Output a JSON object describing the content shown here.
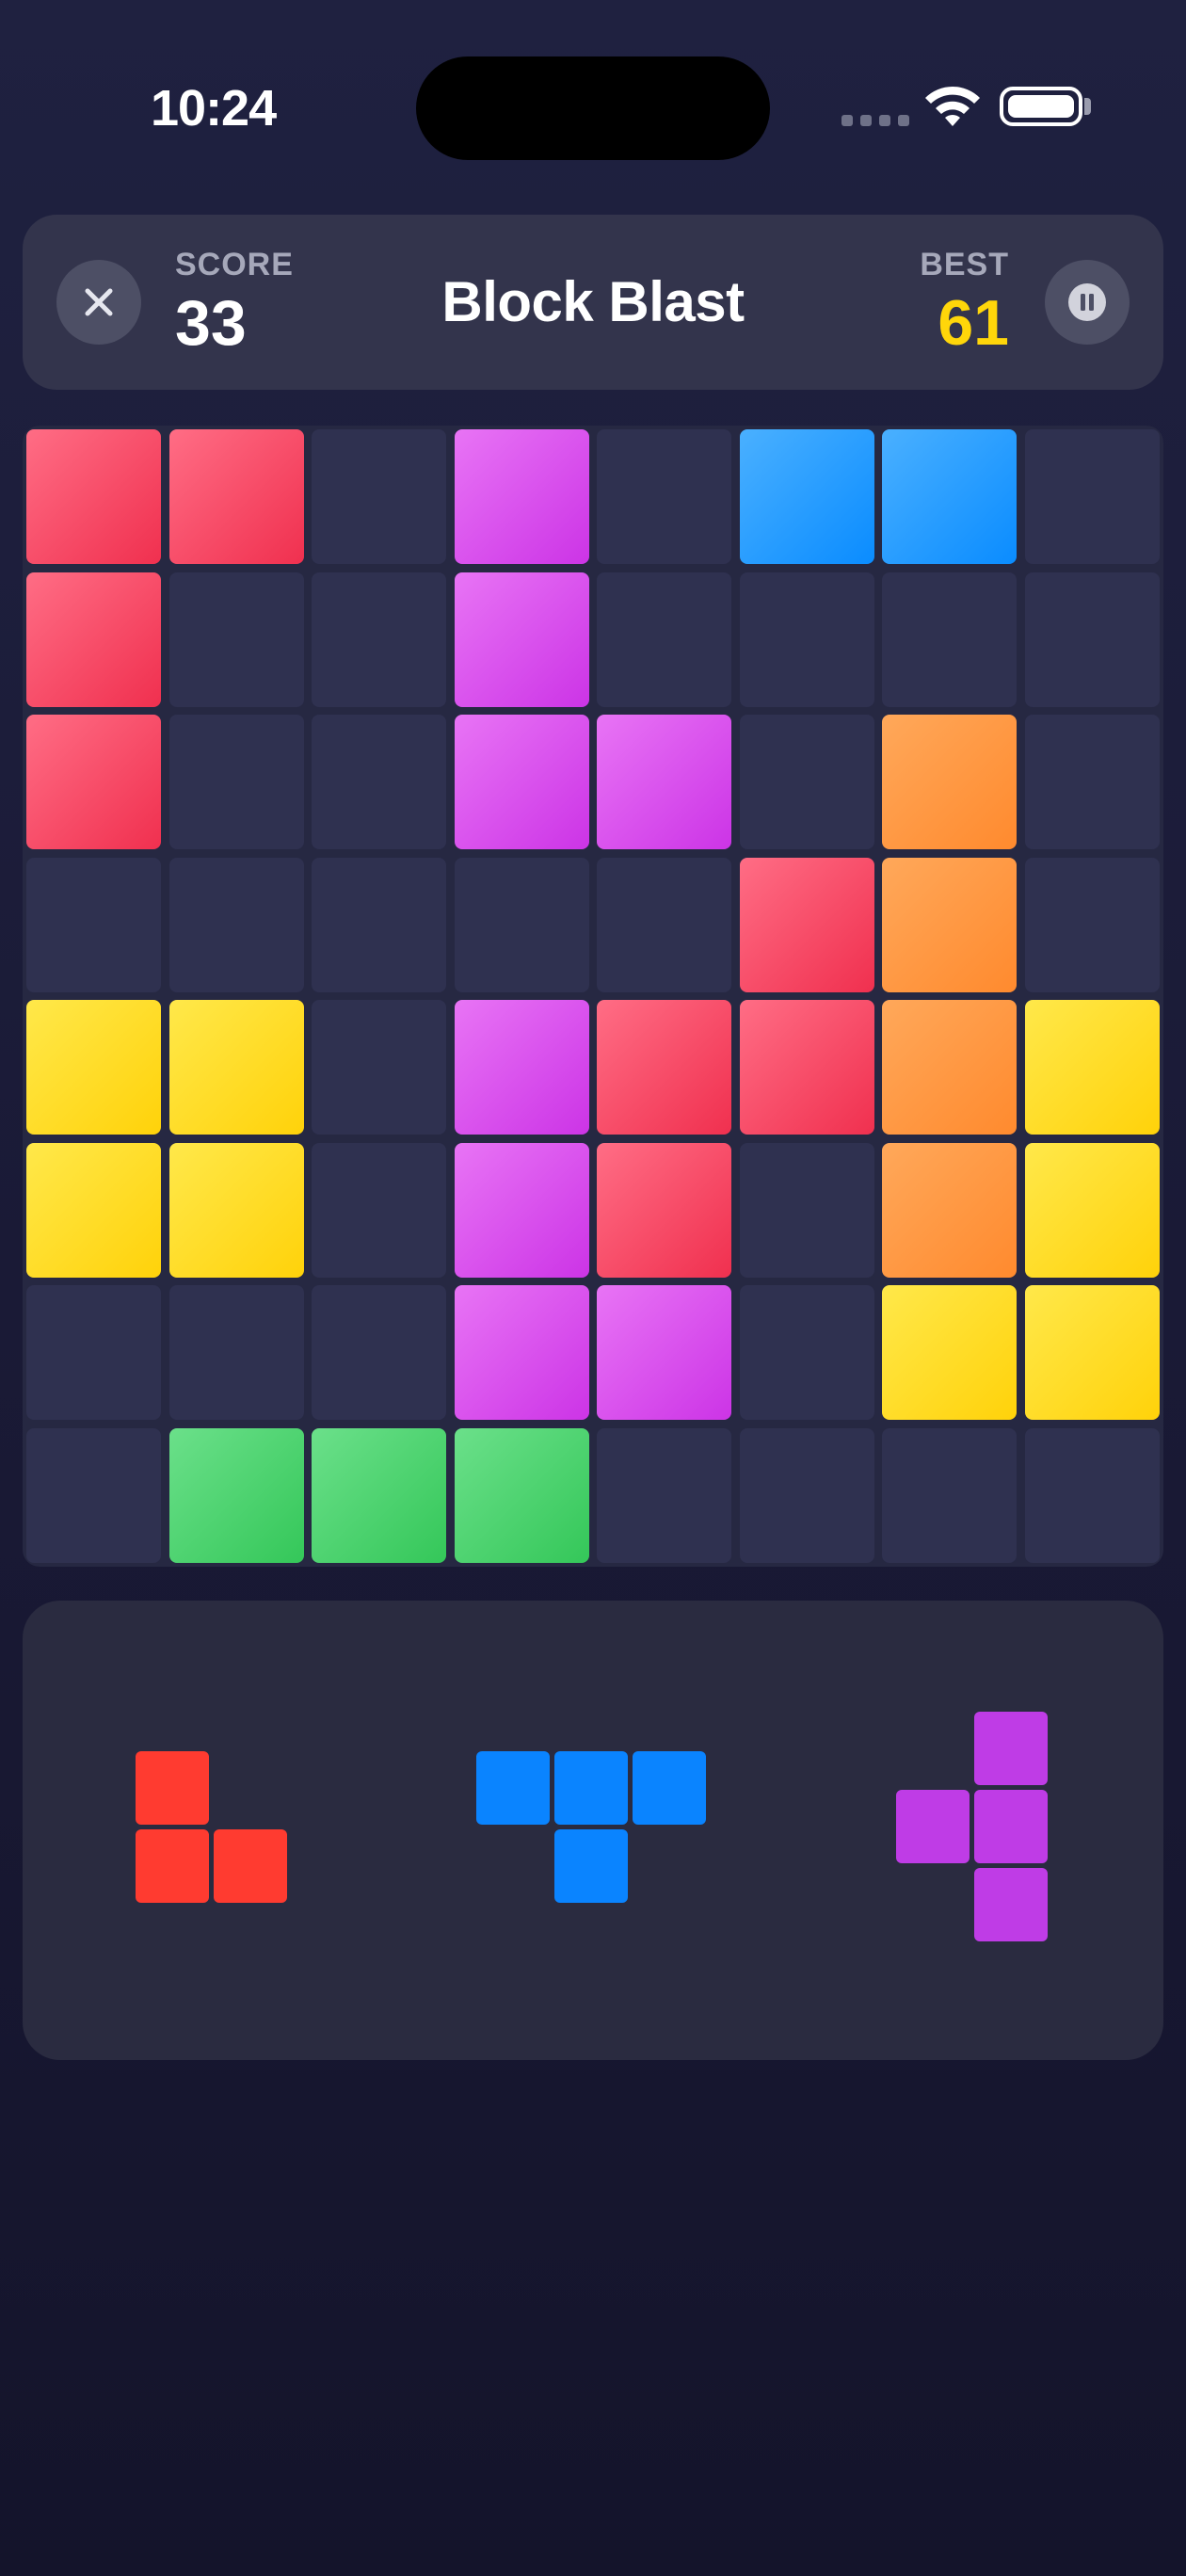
{
  "status": {
    "time": "10:24"
  },
  "header": {
    "score_label": "SCORE",
    "score_value": "33",
    "title": "Block Blast",
    "best_label": "BEST",
    "best_value": "61"
  },
  "colors": {
    "red": "#f0304f",
    "purple": "#cc34e6",
    "blue": "#0a8cff",
    "orange": "#ff8a2e",
    "yellow": "#ffd20a",
    "green": "#34c759",
    "best_accent": "#ffd60a",
    "piece_red": "#ff3b30",
    "piece_blue": "#0a84ff",
    "piece_purple": "#bf3ce6"
  },
  "board": {
    "size": 8,
    "grid": [
      [
        "red",
        "red",
        "",
        "purple",
        "",
        "blue",
        "blue",
        ""
      ],
      [
        "red",
        "",
        "",
        "purple",
        "",
        "",
        "",
        ""
      ],
      [
        "red",
        "",
        "",
        "purple",
        "purple",
        "",
        "orange",
        ""
      ],
      [
        "",
        "",
        "",
        "",
        "",
        "red",
        "orange",
        ""
      ],
      [
        "yellow",
        "yellow",
        "",
        "purple",
        "red",
        "red",
        "orange",
        "yellow"
      ],
      [
        "yellow",
        "yellow",
        "",
        "purple",
        "red",
        "",
        "orange",
        "yellow"
      ],
      [
        "",
        "",
        "",
        "purple",
        "purple",
        "",
        "yellow",
        "yellow"
      ],
      [
        "",
        "green",
        "green",
        "green",
        "",
        "",
        "",
        ""
      ]
    ]
  },
  "pieces": [
    {
      "name": "piece-red-z",
      "color": "#ff3b30",
      "cells": [
        [
          0,
          0
        ],
        [
          1,
          0
        ],
        [
          1,
          1
        ]
      ]
    },
    {
      "name": "piece-blue-t",
      "color": "#0a84ff",
      "cells": [
        [
          0,
          0
        ],
        [
          0,
          1
        ],
        [
          0,
          2
        ],
        [
          1,
          1
        ]
      ]
    },
    {
      "name": "piece-purple-t",
      "color": "#bf3ce6",
      "cells": [
        [
          0,
          1
        ],
        [
          1,
          0
        ],
        [
          1,
          1
        ],
        [
          2,
          1
        ]
      ]
    }
  ],
  "icons": {
    "close": "close-icon",
    "pause": "pause-icon",
    "wifi": "wifi-icon",
    "battery": "battery-icon"
  }
}
